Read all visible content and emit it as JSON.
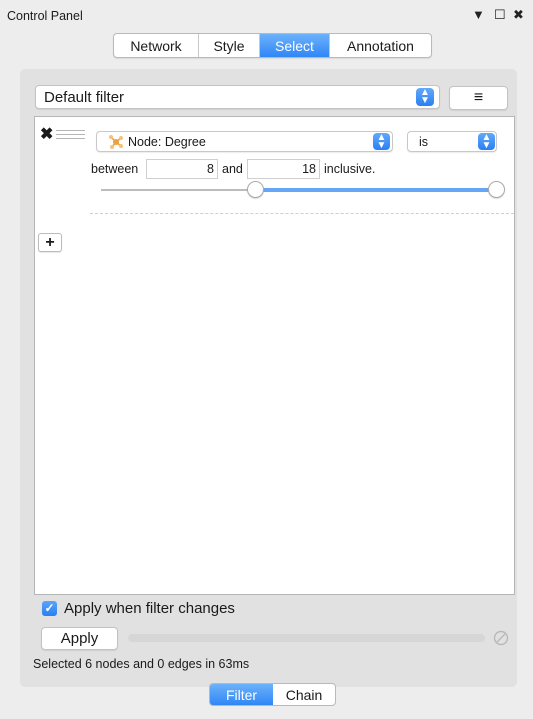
{
  "window": {
    "title": "Control Panel"
  },
  "window_controls": {
    "menu": "▼",
    "float": "☐",
    "close": "✖"
  },
  "tabs": [
    {
      "label": "Network",
      "active": false
    },
    {
      "label": "Style",
      "active": false
    },
    {
      "label": "Select",
      "active": true
    },
    {
      "label": "Annotation",
      "active": false
    }
  ],
  "filter_select": {
    "value": "Default filter"
  },
  "filter_menu": {
    "icon": "hamburger-icon",
    "glyph": "≡"
  },
  "condition": {
    "delete_glyph": "✖",
    "column": "Node: Degree",
    "column_icon": "node-degree-icon",
    "operator": "is",
    "between_label": "between",
    "min_value": "8",
    "and_label": "and",
    "max_value": "18",
    "inclusive_label": "inclusive.",
    "slider": {
      "low_fraction": 0.39,
      "high_fraction": 1.0
    }
  },
  "add_button": {
    "glyph": "+"
  },
  "apply_when_changes": {
    "label": "Apply when filter changes",
    "checked": true
  },
  "apply_button": {
    "label": "Apply"
  },
  "progress": {
    "fraction": 0.0
  },
  "status_text": "Selected 6 nodes and 0 edges in 63ms",
  "bottom_tabs": [
    {
      "label": "Filter",
      "active": true
    },
    {
      "label": "Chain",
      "active": false
    }
  ],
  "colors": {
    "accent": "#2f86f6",
    "slider": "#66a6f7"
  }
}
